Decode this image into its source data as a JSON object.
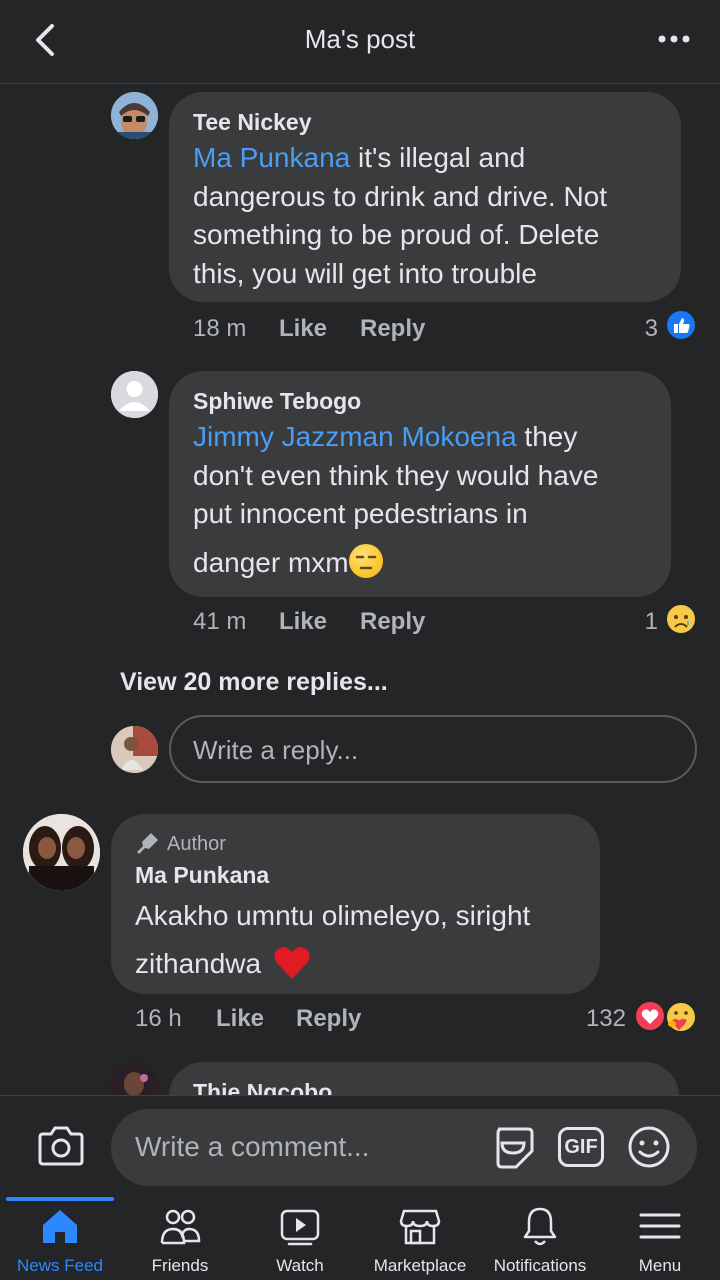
{
  "header": {
    "title": "Ma's post"
  },
  "comments": [
    {
      "name": "Tee Nickey",
      "mention": "Ma Punkana",
      "lines": [
        " it's illegal and",
        "dangerous to drink and drive. Not",
        "something to be proud of. Delete",
        "this, you will get into trouble"
      ],
      "time": "18 m",
      "like": "Like",
      "reply": "Reply",
      "reactions": "3"
    },
    {
      "name": "Sphiwe Tebogo",
      "mention": "Jimmy Jazzman Mokoena",
      "lines": [
        " they",
        "don't even think they would have",
        "put innocent pedestrians in",
        "danger mxm"
      ],
      "time": "41 m",
      "like": "Like",
      "reply": "Reply",
      "reactions": "1"
    }
  ],
  "view_more": "View 20 more replies...",
  "reply_placeholder": "Write a reply...",
  "author_comment": {
    "badge": "Author",
    "name": "Ma Punkana",
    "lines": [
      "Akakho umntu olimeleyo, siright",
      "zithandwa"
    ],
    "time": "16 h",
    "like": "Like",
    "reply": "Reply",
    "reactions": "132"
  },
  "partial_comment": {
    "name": "Thie Ngcobo"
  },
  "comment_placeholder": "Write a comment...",
  "gif_label": "GIF",
  "tabs": [
    {
      "label": "News Feed",
      "icon": "home-icon"
    },
    {
      "label": "Friends",
      "icon": "friends-icon"
    },
    {
      "label": "Watch",
      "icon": "watch-icon"
    },
    {
      "label": "Marketplace",
      "icon": "marketplace-icon"
    },
    {
      "label": "Notifications",
      "icon": "bell-icon"
    },
    {
      "label": "Menu",
      "icon": "menu-icon"
    }
  ],
  "colors": {
    "accent": "#2d88ff",
    "mention": "#4a9cf5",
    "bubble": "#3a3b3c",
    "background": "#242526",
    "like": "#1877f2",
    "love": "#f33e58"
  }
}
